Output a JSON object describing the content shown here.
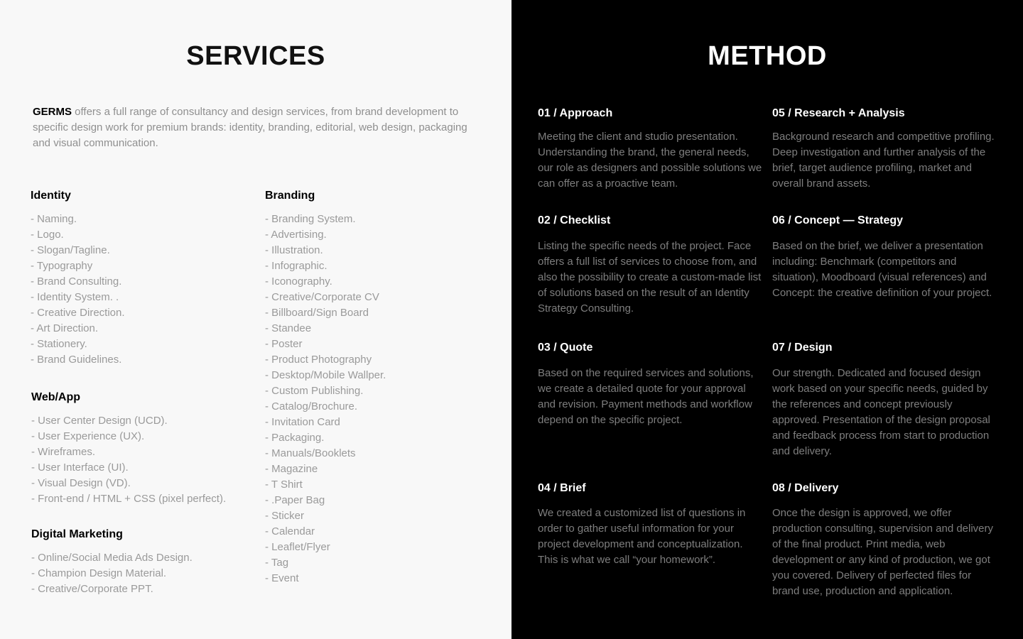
{
  "services": {
    "title": "SERVICES",
    "intro_brand": "GERMS",
    "intro_text": " offers a full range of consultancy and design services, from brand development to specific design work for premium brands: identity, branding, editorial, web design, packaging and visual communication.",
    "groups": [
      {
        "heading": "Identity",
        "items": [
          "- Naming.",
          "- Logo.",
          "- Slogan/Tagline.",
          "- Typography",
          "- Brand Consulting.",
          "- Identity System. .",
          "- Creative Direction.",
          "- Art Direction.",
          "- Stationery.",
          "- Brand Guidelines."
        ]
      },
      {
        "heading": "Web/App",
        "items": [
          "- User Center Design (UCD).",
          "- User Experience (UX).",
          "- Wireframes.",
          "- User Interface (UI).",
          "- Visual Design (VD).",
          "- Front-end / HTML + CSS (pixel perfect)."
        ]
      },
      {
        "heading": "Digital Marketing",
        "items": [
          "- Online/Social Media Ads Design.",
          "- Champion Design Material.",
          "- Creative/Corporate PPT."
        ]
      },
      {
        "heading": "Branding",
        "items": [
          "- Branding System.",
          "- Advertising.",
          "- Illustration.",
          "- Infographic.",
          "- Iconography.",
          "- Creative/Corporate CV",
          "- Billboard/Sign Board",
          "- Standee",
          "- Poster",
          "- Product Photography",
          "- Desktop/Mobile Wallper.",
          "- Custom Publishing.",
          "- Catalog/Brochure.",
          "- Invitation Card",
          "- Packaging.",
          "- Manuals/Booklets",
          "- Magazine",
          "- T Shirt",
          "- .Paper Bag",
          "- Sticker",
          "- Calendar",
          "- Leaflet/Flyer",
          "- Tag",
          "- Event"
        ]
      }
    ]
  },
  "method": {
    "title": "METHOD",
    "steps": [
      {
        "title": "01 / Approach",
        "text": "Meeting the client and studio presentation. Understanding the brand, the general needs, our role as designers and possible solutions we can offer as a proactive team."
      },
      {
        "title": "02 / Checklist",
        "text": "Listing the specific needs of the project. Face offers a full list of services to choose from, and also the possibility to create a custom-made list of solutions based on the result of an Identity Strategy Consulting."
      },
      {
        "title": "03 / Quote",
        "text": "Based on the required services and solutions, we create a detailed quote for your approval and revision. Payment methods and workflow depend on the specific project."
      },
      {
        "title": "04 / Brief",
        "text": "We created a customized list of questions in order to gather useful information for your project development and conceptualization. This is what we call “your homework”."
      },
      {
        "title": "05 / Research + Analysis",
        "text": "Background research and competitive profiling. Deep investigation and further analysis of the brief, target audience profiling, market and overall brand assets."
      },
      {
        "title": "06 / Concept — Strategy",
        "text": "Based on the brief, we deliver a presentation including: Benchmark (competitors and situation), Moodboard (visual references) and Concept: the creative definition of your project."
      },
      {
        "title": "07 / Design",
        "text": "Our strength. Dedicated and focused design work based on your specific needs, guided by the references and concept previously approved. Presentation of the design proposal and feedback process from start to production and delivery."
      },
      {
        "title": "08 / Delivery",
        "text": "Once the design is approved, we offer production consulting, supervision and delivery of the final product. Print media, web development or any kind of production, we got you covered. Delivery of perfected files for brand use, production and application."
      }
    ]
  }
}
